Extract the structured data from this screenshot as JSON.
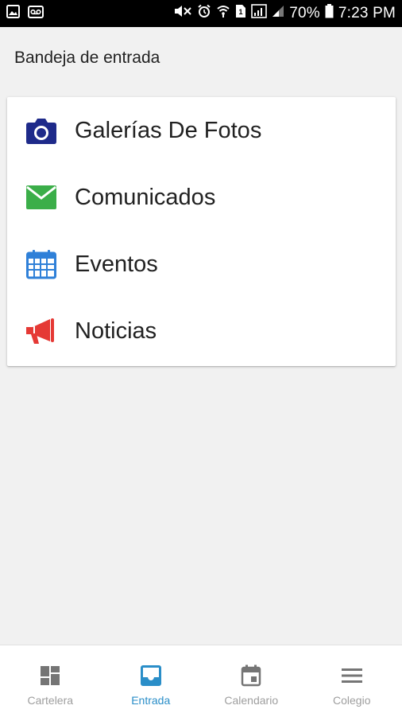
{
  "status_bar": {
    "battery": "70%",
    "time": "7:23 PM"
  },
  "header": {
    "title": "Bandeja de entrada"
  },
  "menu": {
    "items": [
      {
        "label": "Galerías De Fotos",
        "icon": "camera-icon",
        "color": "#1e2a8a"
      },
      {
        "label": "Comunicados",
        "icon": "envelope-icon",
        "color": "#3bae49"
      },
      {
        "label": "Eventos",
        "icon": "calendar-icon",
        "color": "#2f80d8"
      },
      {
        "label": "Noticias",
        "icon": "megaphone-icon",
        "color": "#e53935"
      }
    ]
  },
  "bottom_nav": {
    "active": "Entrada",
    "active_color": "#2a8ec8",
    "inactive_color": "#757575",
    "items": [
      {
        "label": "Cartelera",
        "icon": "dashboard-icon"
      },
      {
        "label": "Entrada",
        "icon": "inbox-icon"
      },
      {
        "label": "Calendario",
        "icon": "calendar-day-icon"
      },
      {
        "label": "Colegio",
        "icon": "menu-lines-icon"
      }
    ]
  }
}
